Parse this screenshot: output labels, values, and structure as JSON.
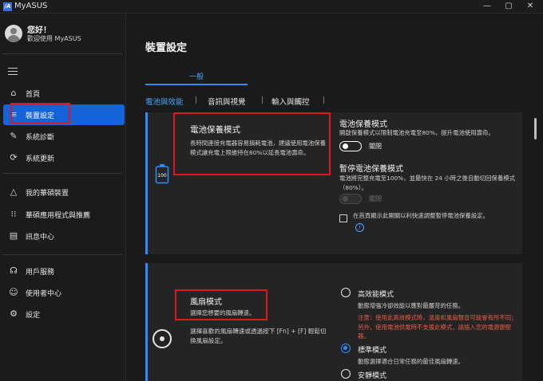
{
  "window": {
    "logo_text": "/A",
    "app_title": "MyASUS",
    "minimize": "—",
    "maximize": "▢",
    "close": "✕"
  },
  "user": {
    "greeting": "您好！",
    "welcome": "歡迎使用 MyASUS"
  },
  "sidebar": {
    "items": [
      {
        "label": "首頁",
        "icon": "home-icon",
        "glyph": "⌂"
      },
      {
        "label": "裝置設定",
        "icon": "sliders-icon",
        "glyph": "≡",
        "active": true
      },
      {
        "label": "系統診斷",
        "icon": "wrench-icon",
        "glyph": "✎"
      },
      {
        "label": "系統更新",
        "icon": "update-icon",
        "glyph": "⟳"
      },
      {
        "label": "我的華碩裝置",
        "icon": "device-icon",
        "glyph": "△"
      },
      {
        "label": "華碩應用程式與推薦",
        "icon": "apps-grid-icon",
        "glyph": "⁝⁝"
      },
      {
        "label": "訊息中心",
        "icon": "message-icon",
        "glyph": "▤"
      },
      {
        "label": "用戶服務",
        "icon": "headset-icon",
        "glyph": "☊"
      },
      {
        "label": "使用者中心",
        "icon": "user-icon",
        "glyph": "☺"
      },
      {
        "label": "設定",
        "icon": "gear-icon",
        "glyph": "⚙"
      }
    ]
  },
  "main": {
    "title": "裝置設定",
    "tab_general": "一般",
    "subtabs": [
      "電池與效能",
      "音訊與視覺",
      "輸入與觸控"
    ],
    "subtab_separator": "|"
  },
  "battery_card": {
    "callout_title": "電池保養模式",
    "callout_desc": "長時間連接充電器容易損耗電池，建議使用電池保養模式讓充電上限維持在80%以延長電池壽命。",
    "battery_icon_text": "100",
    "care_title": "電池保養模式",
    "care_desc": "開啟保養模式以限制電池充電至80%，提升電池使用壽命。",
    "care_toggle_label": "關閉",
    "pause_title": "暫停電池保養模式",
    "pause_desc": "電池將完整充電至100%，並最快在 24 小時之後自動切回保養模式（80%）。",
    "pause_toggle_label": "關閉",
    "shortcut_text": "在首頁顯示此開關以利快速調整暫停電池保養設定。",
    "info_glyph": "i"
  },
  "fan_card": {
    "callout_title": "風扇模式",
    "callout_desc": "選擇您想要的風扇轉速。",
    "desc": "選擇喜歡的風扇轉速或透過按下 [Fn] + [F] 輕鬆切換風扇設定。",
    "options": [
      {
        "label": "高效能模式",
        "desc": "動態增強冷卻效能以應對最嚴苛的任務。",
        "selected": false
      },
      {
        "label": "標準模式",
        "desc": "動態選擇適合日常任務的最佳風扇轉速。",
        "selected": true
      },
      {
        "label": "安靜模式",
        "desc": "",
        "selected": false
      }
    ],
    "warning": "注意：使用此高效模式時，溫度和風扇聲音可能會有所不同；另外，使用電池供電時不支援此模式，請插入您的電源變壓器。"
  },
  "colors": {
    "accent": "#2f8bff",
    "active_nav": "#1463d8",
    "highlight_box": "#e0151f",
    "warning_text": "#e35b48"
  }
}
